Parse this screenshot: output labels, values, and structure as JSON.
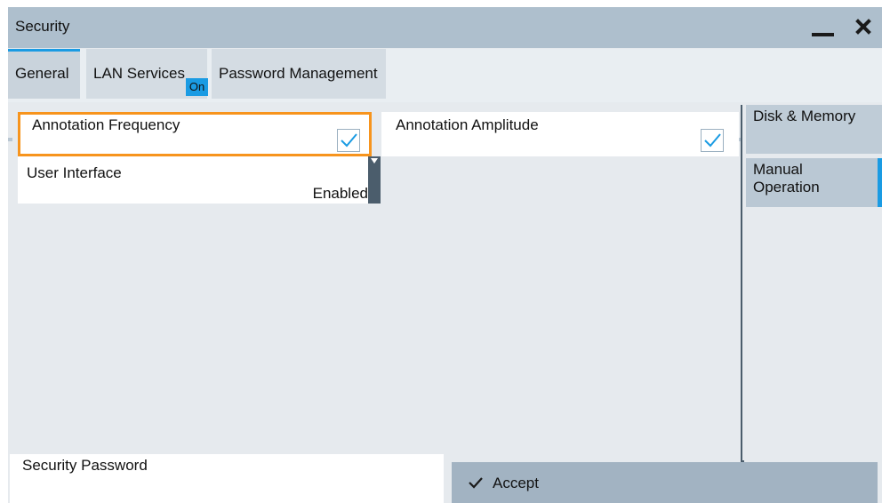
{
  "window": {
    "title": "Security"
  },
  "tabs": [
    {
      "label": "General",
      "active": true
    },
    {
      "label": "LAN Services",
      "badge": "On"
    },
    {
      "label": "Password Management"
    }
  ],
  "general": {
    "annotation_frequency": {
      "label": "Annotation Frequency",
      "checked": true
    },
    "annotation_amplitude": {
      "label": "Annotation Amplitude",
      "checked": true
    },
    "user_interface": {
      "label": "User Interface",
      "value": "Enabled"
    }
  },
  "side_nav": [
    {
      "label": "Disk & Memory"
    },
    {
      "label": "Manual Operation",
      "selected": true
    }
  ],
  "footer": {
    "security_password_label": "Security Password",
    "security_password_value": "",
    "accept_label": "Accept"
  },
  "colors": {
    "accent": "#1a9be3",
    "focus": "#f7941d",
    "titlebar": "#aebfcd"
  },
  "icons": [
    "minimize-icon",
    "close-icon",
    "checkmark-icon",
    "dropdown-arrow-icon"
  ]
}
